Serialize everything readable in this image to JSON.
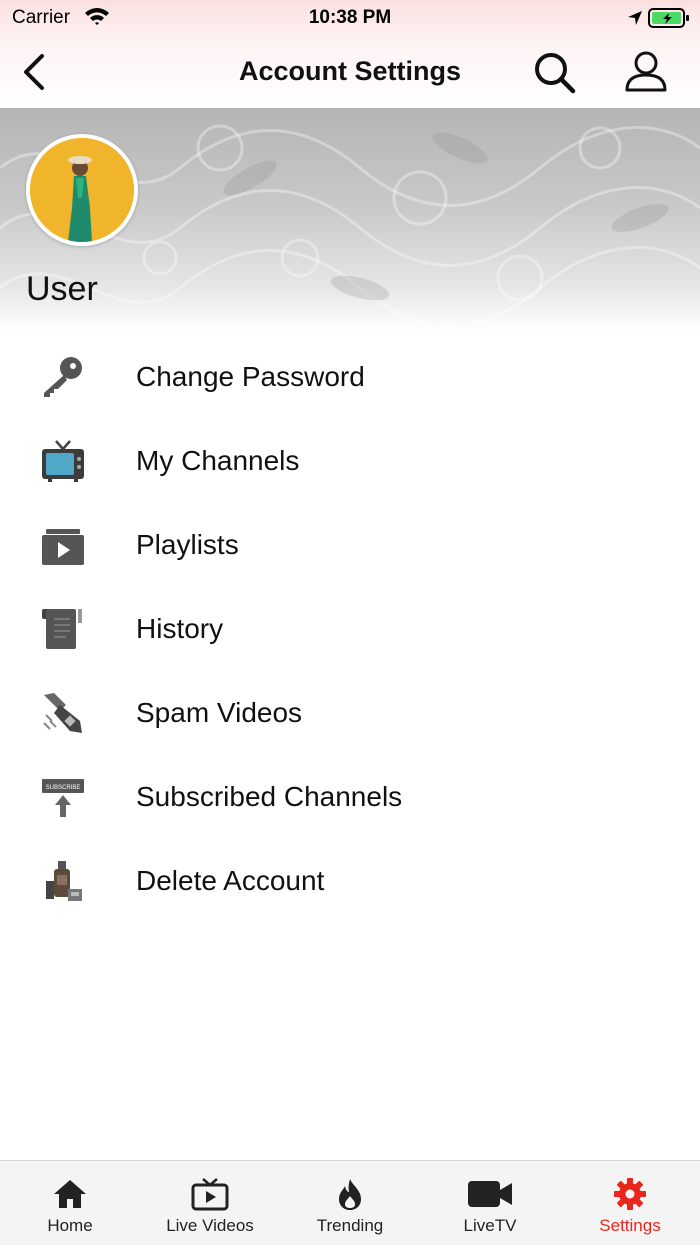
{
  "status_bar": {
    "carrier": "Carrier",
    "time": "10:38 PM"
  },
  "header": {
    "title": "Account Settings"
  },
  "profile": {
    "name": "User"
  },
  "menu": {
    "items": [
      {
        "label": "Change Password",
        "icon": "key-icon"
      },
      {
        "label": "My Channels",
        "icon": "tv-icon"
      },
      {
        "label": "Playlists",
        "icon": "playlist-icon"
      },
      {
        "label": "History",
        "icon": "history-icon"
      },
      {
        "label": "Spam Videos",
        "icon": "spam-icon"
      },
      {
        "label": "Subscribed Channels",
        "icon": "subscribe-icon"
      },
      {
        "label": "Delete Account",
        "icon": "delete-account-icon"
      }
    ],
    "subscribe_badge_text": "SUBSCRIBE"
  },
  "tabbar": {
    "tabs": [
      {
        "label": "Home",
        "icon": "home-icon"
      },
      {
        "label": "Live Videos",
        "icon": "live-videos-icon"
      },
      {
        "label": "Trending",
        "icon": "flame-icon"
      },
      {
        "label": "LiveTV",
        "icon": "video-camera-icon"
      },
      {
        "label": "Settings",
        "icon": "gear-icon",
        "active": true
      }
    ]
  },
  "colors": {
    "accent": "#e8261b",
    "icon_gray": "#555555",
    "battery": "#4cd964"
  }
}
